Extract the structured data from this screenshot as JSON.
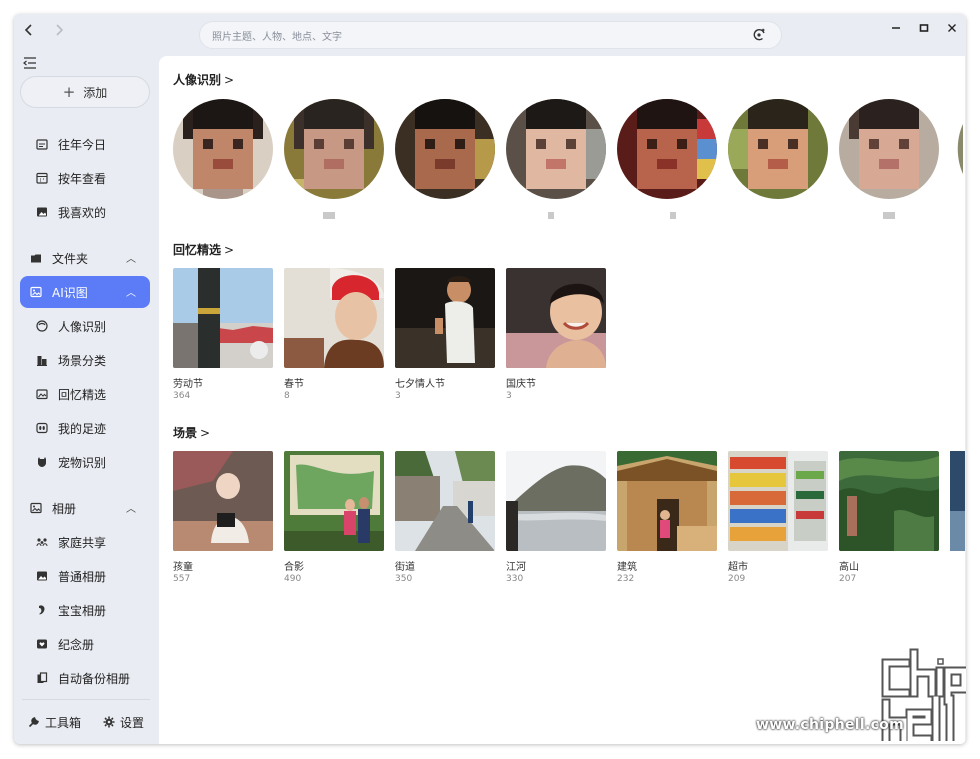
{
  "titlebar": {
    "back_icon": "chevron-left-icon",
    "forward_icon": "chevron-right-icon",
    "search_placeholder": "照片主题、人物、地点、文字",
    "search_icon": "visual-search-icon",
    "minimize_icon": "minimize-icon",
    "maximize_icon": "maximize-icon",
    "close_icon": "close-icon"
  },
  "sidebar": {
    "add_label": "添加",
    "items": [
      {
        "label": "往年今日",
        "icon": "calendar-icon"
      },
      {
        "label": "按年查看",
        "icon": "calendar-grid-icon"
      },
      {
        "label": "我喜欢的",
        "icon": "image-heart-icon"
      }
    ],
    "folder_group": {
      "label": "文件夹",
      "icon": "folder-icon"
    },
    "ai_group": {
      "label": "AI识图",
      "icon": "ai-image-icon"
    },
    "ai_items": [
      {
        "label": "人像识别",
        "icon": "face-icon"
      },
      {
        "label": "场景分类",
        "icon": "scene-icon"
      },
      {
        "label": "回忆精选",
        "icon": "memory-icon"
      },
      {
        "label": "我的足迹",
        "icon": "footprint-icon"
      },
      {
        "label": "宠物识别",
        "icon": "pet-icon"
      }
    ],
    "album_group": {
      "label": "相册",
      "icon": "album-icon"
    },
    "album_items": [
      {
        "label": "家庭共享",
        "icon": "family-icon"
      },
      {
        "label": "普通相册",
        "icon": "photo-album-icon"
      },
      {
        "label": "宝宝相册",
        "icon": "baby-icon"
      },
      {
        "label": "纪念册",
        "icon": "memorial-icon"
      },
      {
        "label": "自动备份相册",
        "icon": "backup-icon"
      }
    ],
    "toolbox_label": "工具箱",
    "settings_label": "设置"
  },
  "main": {
    "faces_title": "人像识别",
    "memories_title": "回忆精选",
    "memories": [
      {
        "name": "劳动节",
        "count": "364"
      },
      {
        "name": "春节",
        "count": "8"
      },
      {
        "name": "七夕情人节",
        "count": "3"
      },
      {
        "name": "国庆节",
        "count": "3"
      }
    ],
    "scenes_title": "场景",
    "scenes": [
      {
        "name": "孩童",
        "count": "557"
      },
      {
        "name": "合影",
        "count": "490"
      },
      {
        "name": "街道",
        "count": "350"
      },
      {
        "name": "江河",
        "count": "330"
      },
      {
        "name": "建筑",
        "count": "232"
      },
      {
        "name": "超市",
        "count": "209"
      },
      {
        "name": "高山",
        "count": "207"
      }
    ]
  },
  "watermark": {
    "logo": "chiphell-logo",
    "url": "www.chiphell.com"
  },
  "colors": {
    "accent": "#5b7cf6",
    "sidebar_bg": "#e9ecf2",
    "content_bg": "#ffffff"
  }
}
